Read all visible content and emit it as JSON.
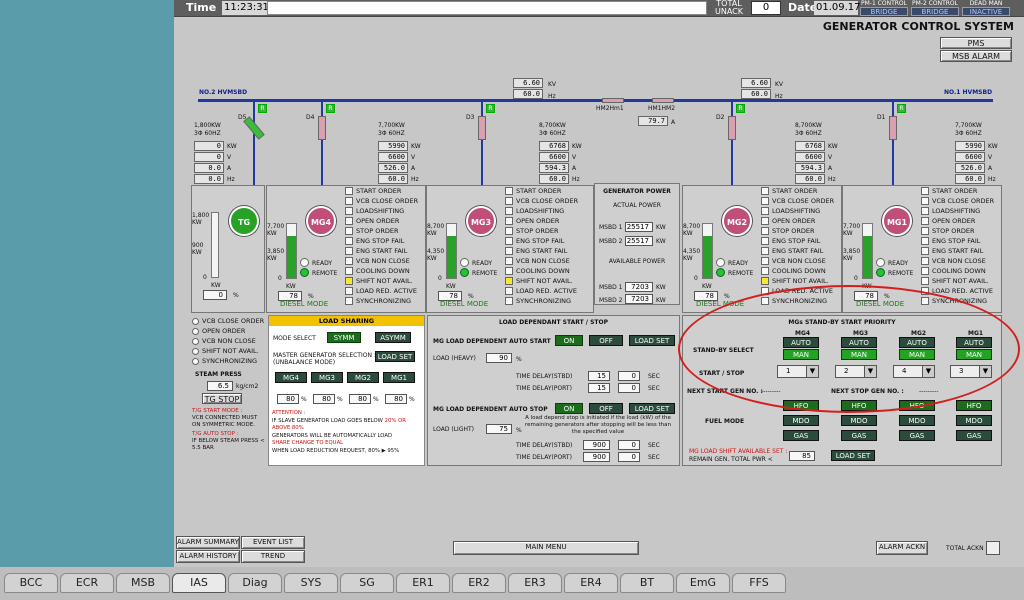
{
  "topbar": {
    "time_label": "Time",
    "time_value": "11:23:31",
    "total_unack": "TOTAL UNACK",
    "unack_value": "0",
    "date_label": "Date",
    "date_value": "01.09.17",
    "controls": [
      {
        "header": "PM-1 CONTROL",
        "value": "BRIDGE"
      },
      {
        "header": "PM-2 CONTROL",
        "value": "BRIDGE"
      },
      {
        "header": "DEAD MAN",
        "value": "INACTIVE"
      }
    ]
  },
  "title": "GENERATOR CONTROL SYSTEM",
  "pms_button": "PMS",
  "msb_alarm_button": "MSB ALARM",
  "bus": {
    "left": "NO.2 HVMSBD",
    "right": "NO.1 HVMSBD",
    "left_kv": "6.60",
    "left_hz": "60.0",
    "right_kv": "6.60",
    "right_hz": "60.0",
    "kv": "KV",
    "hz": "Hz",
    "hm2": "HM2Hm1",
    "hm1": "HM1HM2",
    "tie_a": "79.7",
    "a": "A"
  },
  "gens": [
    {
      "name": "TG",
      "rating": "1,800KW",
      "ph": "3Φ 60HZ",
      "breaker": "D5",
      "kw": "0",
      "v": "0",
      "a": "0.0",
      "hz": "0.0",
      "bar_top": "1,800",
      "bar_mid": "900",
      "bar_bot": "0",
      "pct": "0",
      "mode": ""
    },
    {
      "name": "MG4",
      "rating": "7,700KW",
      "ph": "3Φ 60HZ",
      "breaker": "D4",
      "kw": "5990",
      "v": "6600",
      "a": "526.0",
      "hz": "60.0",
      "bar_top": "7,700",
      "bar_mid": "3,850",
      "bar_bot": "0",
      "pct": "78",
      "mode": "DIESEL MODE"
    },
    {
      "name": "MG3",
      "rating": "8,700KW",
      "ph": "3Φ 60HZ",
      "breaker": "D3",
      "kw": "6768",
      "v": "6600",
      "a": "594.3",
      "hz": "60.0",
      "bar_top": "8,700",
      "bar_mid": "4,350",
      "bar_bot": "0",
      "pct": "78",
      "mode": "DIESEL MODE"
    },
    {
      "name": "MG2",
      "rating": "8,700KW",
      "ph": "3Φ 60HZ",
      "breaker": "D2",
      "kw": "6768",
      "v": "6600",
      "a": "594.3",
      "hz": "60.0",
      "bar_top": "8,700",
      "bar_mid": "4,350",
      "bar_bot": "0",
      "pct": "78",
      "mode": "DIESEL MODE"
    },
    {
      "name": "MG1",
      "rating": "7,700KW",
      "ph": "3Φ 60HZ",
      "breaker": "D1",
      "kw": "5990",
      "v": "6600",
      "a": "526.0",
      "hz": "60.0",
      "bar_top": "7,700",
      "bar_mid": "3,850",
      "bar_bot": "0",
      "pct": "78",
      "mode": "DIESEL MODE"
    }
  ],
  "units": {
    "kw": "KW",
    "v": "V",
    "a": "A",
    "hz": "Hz",
    "pct": "%",
    "ready": "READY",
    "remote": "REMOTE"
  },
  "status_list": [
    "START ORDER",
    "VCB CLOSE ORDER",
    "LOADSHIFTING",
    "OPEN ORDER",
    "STOP ORDER",
    "ENG STOP FAIL",
    "ENG START FAIL",
    "VCB NON CLOSE",
    "COOLING DOWN",
    "SHIFT NOT AVAIL.",
    "LOAD RED. ACTIVE",
    "SYNCHRONIZING"
  ],
  "gen_power": {
    "title": "GENERATOR POWER",
    "actual": "ACTUAL POWER",
    "msbd1_label": "MSBD 1",
    "msbd1": "25517",
    "msbd2_label": "MSBD 2",
    "msbd2": "25517",
    "available": "AVAILABLE POWER",
    "av1_label": "MSBD 1",
    "av1": "7203",
    "av2_label": "MSBD 2",
    "av2": "7203",
    "unit": "KW"
  },
  "tg_status": [
    "VCB CLOSE ORDER",
    "OPEN ORDER",
    "VCB NON CLOSE",
    "SHIFT NOT AVAIL.",
    "SYNCHRONIZING"
  ],
  "steam": {
    "label": "STEAM PRESS",
    "value": "6.5",
    "unit": "kg/cm2",
    "stop": "TG STOP"
  },
  "tg_note": {
    "start_title": "T/G START MODE :",
    "start_text": "VCB CONNECTED MUST ON SYMMETRIC MODE.",
    "stop_title": "T/G AUTO STOP :",
    "stop_text": "IF BELOW STEAM PRESS < 5.5 BAR"
  },
  "load_sharing": {
    "title": "LOAD SHARING",
    "mode_select": "MODE SELECT",
    "symm": "SYMM",
    "asymm": "ASYMM",
    "master_sel": "MASTER GENERATOR SELECTION :",
    "unbalance": "(UNBALANCE MODE)",
    "load_set": "LOAD SET",
    "gens": [
      "MG4",
      "MG3",
      "MG2",
      "MG1"
    ],
    "pcts": [
      "80",
      "80",
      "80",
      "80"
    ],
    "pct": "%",
    "attention": "ATTENTION :",
    "att1a": "IF SLAVE GENERATOR LOAD GOES BELOW",
    "att1b": "20% OR ABOVE 80%",
    "att2a": "GENERATORS WILL BE AUTOMATICALLY LOAD",
    "att2b": "SHARE CHANGE TO EQUAL",
    "att3": "WHEN LOAD REDUCTION REQUEST, 80% ▶ 95%"
  },
  "ldss": {
    "title": "LOAD DEPENDANT START / STOP",
    "start_label": "MG LOAD DEPENDENT AUTO START",
    "on": "ON",
    "off": "OFF",
    "load_set": "LOAD SET",
    "heavy_label": "LOAD (HEAVY)",
    "heavy": "90",
    "pct": "%",
    "td_stbd": "TIME DELAY(STBD)",
    "td_port": "TIME DELAY(PORT)",
    "start_stbd_a": "15",
    "start_stbd_b": "0",
    "start_port_a": "15",
    "start_port_b": "0",
    "sec": "SEC",
    "stop_label": "MG LOAD DEPENDENT AUTO STOP",
    "light_label": "LOAD (LIGHT)",
    "light": "75",
    "stop_note": "A load depend stop is initiated if the load (kW) of the remaining generators after stopping will be less than the specified value",
    "stop_stbd_a": "900",
    "stop_stbd_b": "0",
    "stop_port_a": "900",
    "stop_port_b": "0"
  },
  "standby": {
    "title": "MGs STAND-BY START PRIORITY",
    "gens": [
      "MG4",
      "MG3",
      "MG2",
      "MG1"
    ],
    "sel_label": "STAND-BY SELECT",
    "auto": "AUTO",
    "man": "MAN",
    "ss_label": "START / STOP",
    "priorities": [
      "1",
      "2",
      "4",
      "3"
    ],
    "next_start": "NEXT START GEN NO. :",
    "next_start_v": "---------",
    "next_stop": "NEXT STOP GEN NO. :",
    "next_stop_v": "---------",
    "fuel": "FUEL MODE",
    "hfo": "HFO",
    "mdo": "MDO",
    "gas": "GAS",
    "shift_label": "MG LOAD SHIFT AVAILABLE SET :",
    "remain": "REMAIN GEN. TOTAL PWR <",
    "shift_v": "85",
    "load_set": "LOAD SET"
  },
  "bottom": {
    "alarm_summary": "ALARM SUMMARY",
    "event_list": "EVENT LIST",
    "alarm_history": "ALARM HISTORY",
    "trend": "TREND",
    "main_menu": "MAIN MENU",
    "alarm_ackn": "ALARM ACKN",
    "total_ackn": "TOTAL ACKN"
  },
  "tabs": [
    "BCC",
    "ECR",
    "MSB",
    "IAS",
    "Diag",
    "SYS",
    "SG",
    "ER1",
    "ER2",
    "ER3",
    "ER4",
    "BT",
    "EmG",
    "FFS"
  ],
  "selected_tab": "IAS",
  "colors": {
    "gen_pink": "#c04e78",
    "tg_green": "#27a227",
    "annotation": "#d41e1e"
  }
}
